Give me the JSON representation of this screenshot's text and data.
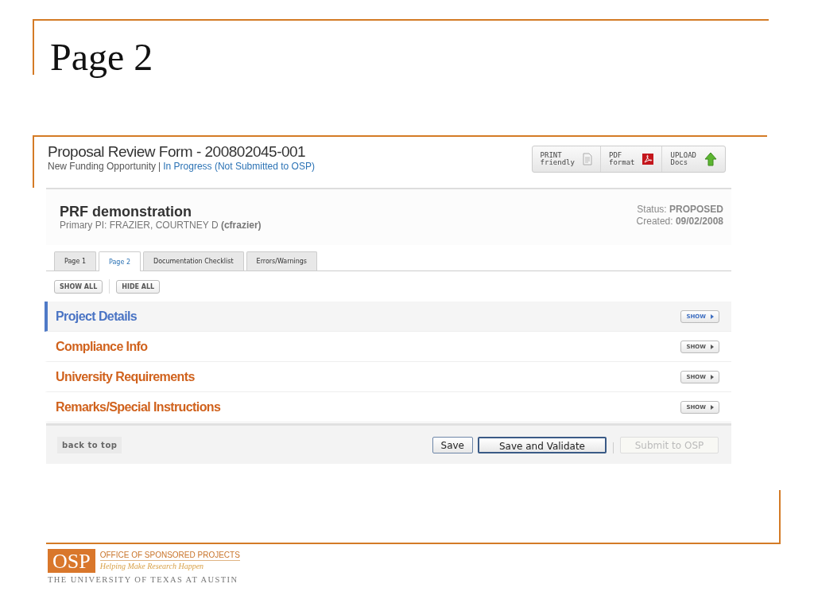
{
  "slide": {
    "title": "Page 2"
  },
  "form": {
    "title": "Proposal Review Form - 200802045-001",
    "type": "New Funding Opportunity",
    "separator": "|",
    "state": "In Progress (Not Submitted to OSP)"
  },
  "toolbar": [
    {
      "kind": "print",
      "line1": "PRINT",
      "line2": "friendly"
    },
    {
      "kind": "pdf",
      "line1": "PDF",
      "line2": "format"
    },
    {
      "kind": "upload",
      "line1": "UPLOAD",
      "line2": "Docs"
    }
  ],
  "project": {
    "name": "PRF demonstration",
    "pi": "Primary PI: FRAZIER, COURTNEY D **(cfrazier)**",
    "status": "Status: **PROPOSED**",
    "created": "Created: **09/02/2008**"
  },
  "tabs": [
    {
      "label": "Page 1",
      "selected": false
    },
    {
      "label": "Page 2",
      "selected": true
    },
    {
      "label": "Documentation Checklist",
      "selected": false
    },
    {
      "label": "Errors/Warnings",
      "selected": false
    }
  ],
  "toggles": [
    "SHOW ALL",
    "HIDE ALL"
  ],
  "sections": [
    {
      "title": "Project Details",
      "selected": true,
      "button": "SHOW"
    },
    {
      "title": "Compliance Info",
      "selected": false,
      "button": "SHOW"
    },
    {
      "title": "University Requirements",
      "selected": false,
      "button": "SHOW"
    },
    {
      "title": "Remarks/Special Instructions",
      "selected": false,
      "button": "SHOW"
    }
  ],
  "footer": {
    "back_to_top": "back to top",
    "buttons": [
      {
        "label": "Save",
        "disabled": false
      },
      {
        "label": "Save and Validate",
        "disabled": false
      },
      {
        "label": "Submit to OSP",
        "disabled": true
      }
    ]
  },
  "logo": {
    "mark": "OSP",
    "office": "OFFICE OF SPONSORED PROJECTS",
    "tagline": "Helping Make Research Happen",
    "university": "THE UNIVERSITY OF TEXAS AT AUSTIN"
  }
}
